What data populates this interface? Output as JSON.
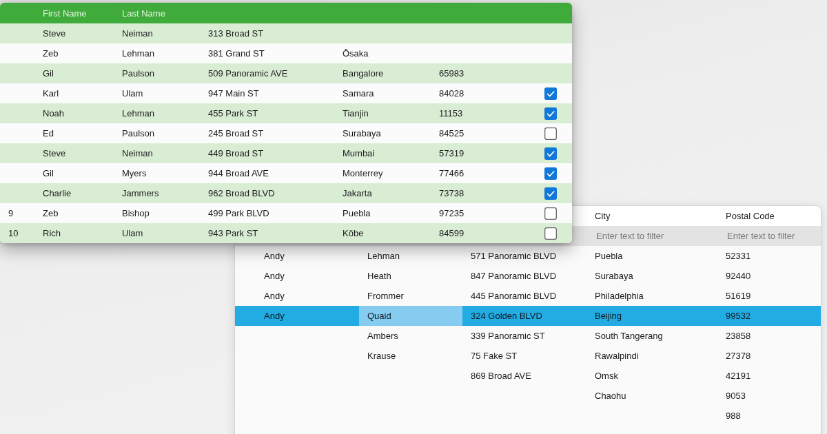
{
  "front_grid": {
    "columns": {
      "first_name": "First Name",
      "last_name": "Last Name"
    },
    "rows": [
      {
        "first_name": "Steve",
        "last_name": "Neiman",
        "address": "313 Broad ST"
      },
      {
        "first_name": "Zeb",
        "last_name": "Lehman",
        "address": "381 Grand ST",
        "city": "Ōsaka"
      },
      {
        "first_name": "Gil",
        "last_name": "Paulson",
        "address": "509 Panoramic AVE",
        "city": "Bangalore",
        "postal_code": "65983"
      },
      {
        "first_name": "Karl",
        "last_name": "Ulam",
        "address": "947 Main ST",
        "city": "Samara",
        "postal_code": "84028",
        "checked": true
      },
      {
        "first_name": "Noah",
        "last_name": "Lehman",
        "address": "455 Park ST",
        "city": "Tianjin",
        "postal_code": "11153",
        "checked": true
      },
      {
        "first_name": "Ed",
        "last_name": "Paulson",
        "address": "245 Broad ST",
        "city": "Surabaya",
        "postal_code": "84525",
        "checked": false
      },
      {
        "first_name": "Steve",
        "last_name": "Neiman",
        "address": "449 Broad ST",
        "city": "Mumbai",
        "postal_code": "57319",
        "checked": true
      },
      {
        "first_name": "Gil",
        "last_name": "Myers",
        "address": "944 Broad AVE",
        "city": "Monterrey",
        "postal_code": "77466",
        "checked": true
      },
      {
        "first_name": "Charlie",
        "last_name": "Jammers",
        "address": "962 Broad BLVD",
        "city": "Jakarta",
        "postal_code": "73738",
        "checked": true
      },
      {
        "number": "9",
        "first_name": "Zeb",
        "last_name": "Bishop",
        "address": "499 Park BLVD",
        "city": "Puebla",
        "postal_code": "97235",
        "checked": false
      },
      {
        "number": "10",
        "first_name": "Rich",
        "last_name": "Ulam",
        "address": "943 Park ST",
        "city": "Köbe",
        "postal_code": "84599",
        "checked": false
      }
    ]
  },
  "back_grid": {
    "columns": {
      "city": "City",
      "postal_code": "Postal Code"
    },
    "filters": {
      "city": {
        "placeholder": "Enter text to filter"
      },
      "postal_code": {
        "placeholder": "Enter text to filter"
      }
    },
    "rows": [
      {
        "first_name": "Andy",
        "last_name": "Lehman",
        "address": "571 Panoramic BLVD",
        "city": "Puebla",
        "postal_code": "52331",
        "selected": false
      },
      {
        "first_name": "Andy",
        "last_name": "Heath",
        "address": "847 Panoramic BLVD",
        "city": "Surabaya",
        "postal_code": "92440",
        "selected": false
      },
      {
        "first_name": "Andy",
        "last_name": "Frommer",
        "address": "445 Panoramic BLVD",
        "city": "Philadelphia",
        "postal_code": "51619",
        "selected": false
      },
      {
        "first_name": "Andy",
        "last_name": {
          "text": "Quaid",
          "focused": true
        },
        "address": "324 Golden BLVD",
        "city": "Beijing",
        "postal_code": "99532",
        "selected": true
      },
      {
        "last_name": "Ambers",
        "address": "339 Panoramic ST",
        "city": "South Tangerang",
        "postal_code": "23858",
        "selected": false
      },
      {
        "last_name": "Krause",
        "address": "75 Fake ST",
        "city": "Rawalpindi",
        "postal_code": "27378",
        "selected": false
      },
      {
        "address": "869 Broad AVE",
        "city": "Omsk",
        "postal_code": "42191",
        "selected": false
      },
      {
        "city": "Chaohu",
        "postal_code": "9053",
        "selected": false
      },
      {
        "postal_code": "988",
        "selected": false
      }
    ]
  }
}
